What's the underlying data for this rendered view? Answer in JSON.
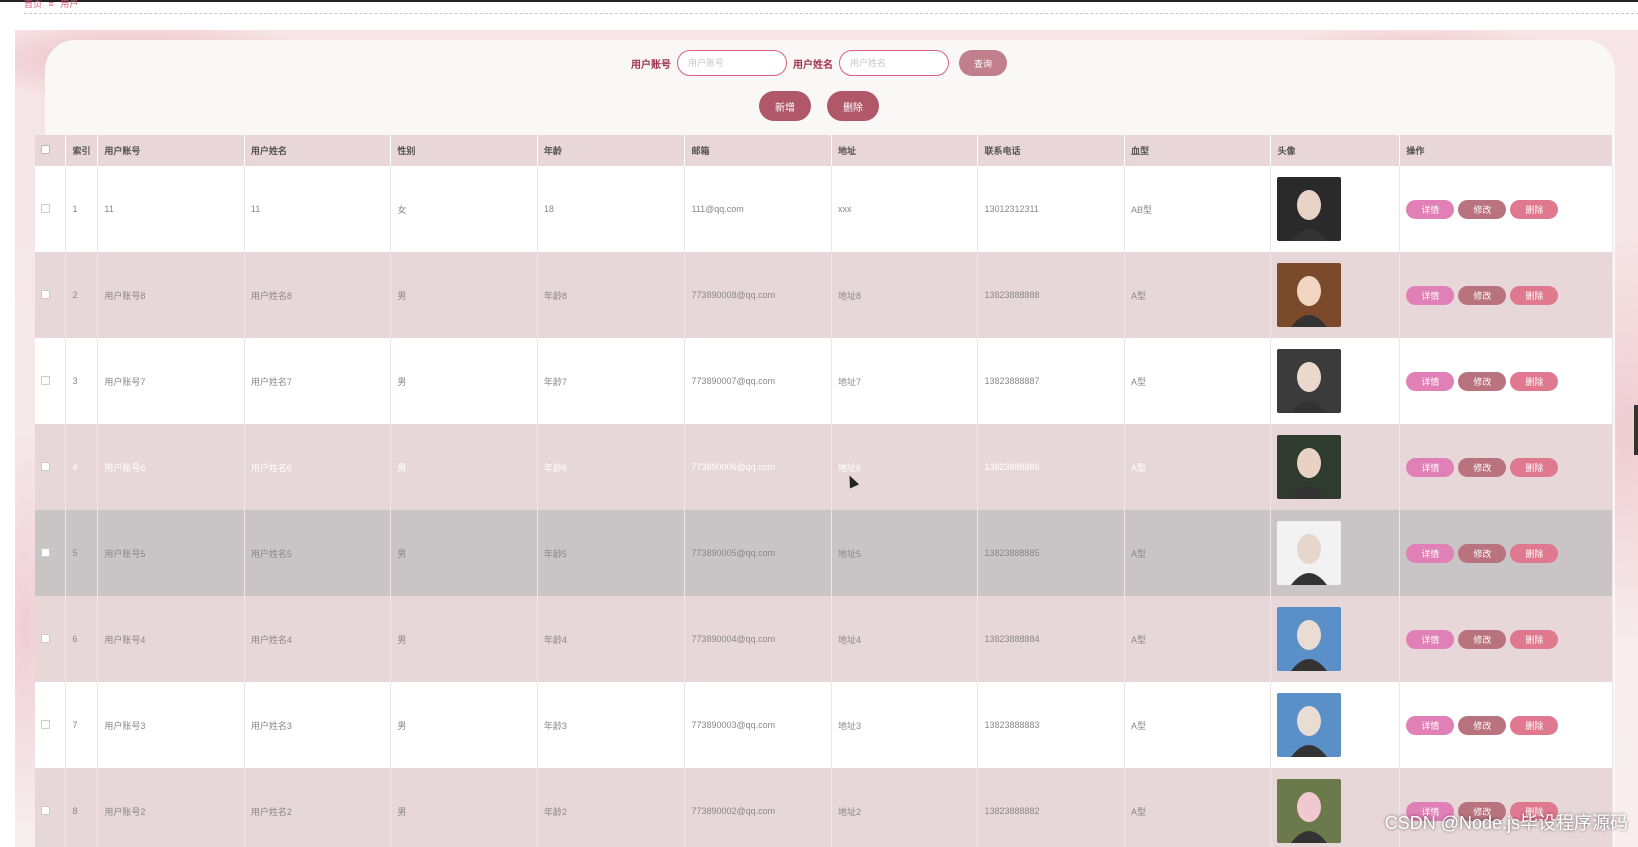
{
  "breadcrumb": {
    "home": "首页",
    "separator": "≡",
    "current": "用户"
  },
  "search": {
    "account_label": "用户账号",
    "account_placeholder": "用户账号",
    "name_label": "用户姓名",
    "name_placeholder": "用户姓名",
    "query_label": "查询"
  },
  "actions": {
    "add_label": "新增",
    "delete_label": "删除"
  },
  "table": {
    "headers": [
      "索引",
      "用户账号",
      "用户姓名",
      "性别",
      "年龄",
      "邮箱",
      "地址",
      "联系电话",
      "血型",
      "头像",
      "操作"
    ],
    "op_labels": {
      "detail": "详情",
      "edit": "修改",
      "delete": "删除"
    },
    "rows": [
      {
        "index": "1",
        "account": "11",
        "name": "11",
        "gender": "女",
        "age": "18",
        "email": "111@qq.com",
        "address": "xxx",
        "phone": "13012312311",
        "blood": "AB型"
      },
      {
        "index": "2",
        "account": "用户账号8",
        "name": "用户姓名8",
        "gender": "男",
        "age": "年龄8",
        "email": "773890008@qq.com",
        "address": "地址8",
        "phone": "13823888888",
        "blood": "A型"
      },
      {
        "index": "3",
        "account": "用户账号7",
        "name": "用户姓名7",
        "gender": "男",
        "age": "年龄7",
        "email": "773890007@qq.com",
        "address": "地址7",
        "phone": "13823888887",
        "blood": "A型"
      },
      {
        "index": "4",
        "account": "用户账号6",
        "name": "用户姓名6",
        "gender": "男",
        "age": "年龄6",
        "email": "773890006@qq.com",
        "address": "地址6",
        "phone": "13823888886",
        "blood": "A型"
      },
      {
        "index": "5",
        "account": "用户账号5",
        "name": "用户姓名5",
        "gender": "男",
        "age": "年龄5",
        "email": "773890005@qq.com",
        "address": "地址5",
        "phone": "13823888885",
        "blood": "A型"
      },
      {
        "index": "6",
        "account": "用户账号4",
        "name": "用户姓名4",
        "gender": "男",
        "age": "年龄4",
        "email": "773890004@qq.com",
        "address": "地址4",
        "phone": "13823888884",
        "blood": "A型"
      },
      {
        "index": "7",
        "account": "用户账号3",
        "name": "用户姓名3",
        "gender": "男",
        "age": "年龄3",
        "email": "773890003@qq.com",
        "address": "地址3",
        "phone": "13823888883",
        "blood": "A型"
      },
      {
        "index": "8",
        "account": "用户账号2",
        "name": "用户姓名2",
        "gender": "男",
        "age": "年龄2",
        "email": "773890002@qq.com",
        "address": "地址2",
        "phone": "13823888882",
        "blood": "A型"
      }
    ]
  },
  "watermark": "CSDN @Node.js毕设程序源码"
}
